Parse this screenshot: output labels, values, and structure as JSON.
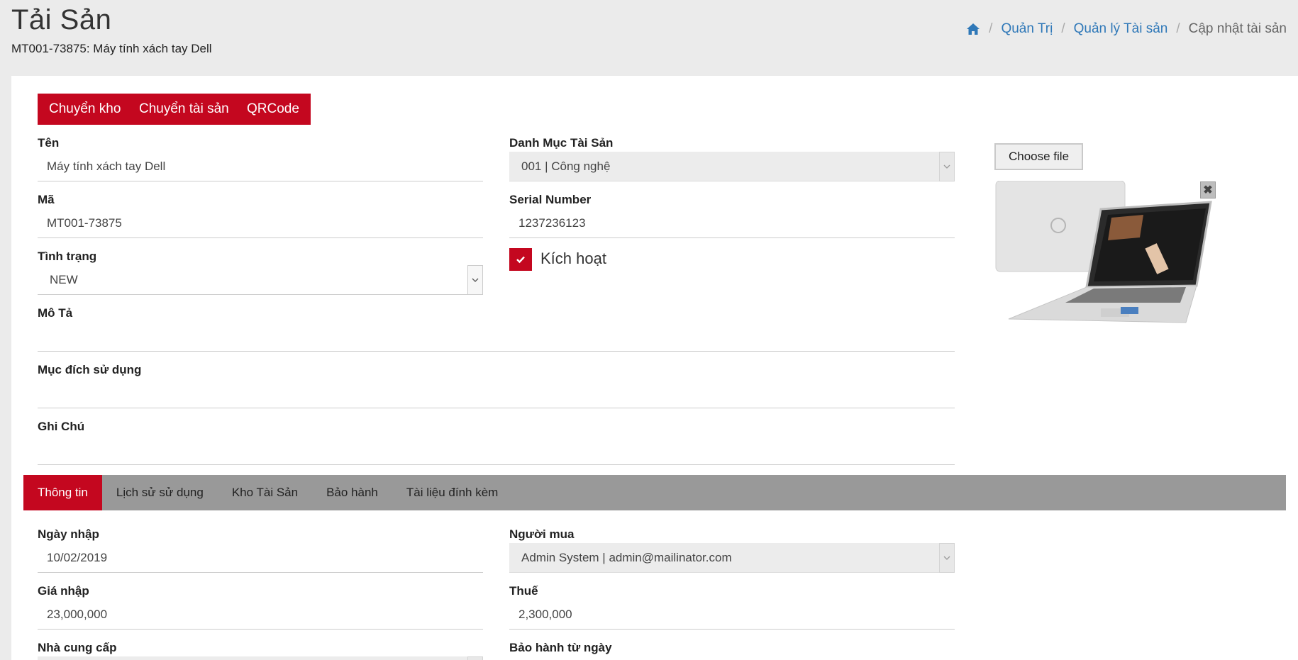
{
  "header": {
    "title": "Tải Sản",
    "subtitle": "MT001-73875: Máy tính xách tay Dell"
  },
  "breadcrumb": {
    "home_icon": "home-icon",
    "items": [
      "Quản Trị",
      "Quản lý Tài sản"
    ],
    "current": "Cập nhật tài sản",
    "separator": "/"
  },
  "actions": {
    "transfer_warehouse": "Chuyển kho",
    "transfer_asset": "Chuyển tài sản",
    "qrcode": "QRCode"
  },
  "form": {
    "name": {
      "label": "Tên",
      "value": "Máy tính xách tay Dell"
    },
    "category": {
      "label": "Danh Mục Tài Sản",
      "value": "001 | Công nghệ"
    },
    "code": {
      "label": "Mã",
      "value": "MT001-73875"
    },
    "serial": {
      "label": "Serial Number",
      "value": "1237236123"
    },
    "status": {
      "label": "Tình trạng",
      "value": "NEW"
    },
    "active": {
      "label": "Kích hoạt",
      "checked": true
    },
    "description": {
      "label": "Mô Tả",
      "value": ""
    },
    "purpose": {
      "label": "Mục đích sử dụng",
      "value": ""
    },
    "note": {
      "label": "Ghi Chú",
      "value": ""
    }
  },
  "upload": {
    "choose_file": "Choose file",
    "close_symbol": "✖"
  },
  "tabs": [
    {
      "label": "Thông tin",
      "active": true
    },
    {
      "label": "Lịch sử sử dụng",
      "active": false
    },
    {
      "label": "Kho Tài Sản",
      "active": false
    },
    {
      "label": "Bảo hành",
      "active": false
    },
    {
      "label": "Tài liệu đính kèm",
      "active": false
    }
  ],
  "info": {
    "import_date": {
      "label": "Ngày nhập",
      "value": "10/02/2019"
    },
    "buyer": {
      "label": "Người mua",
      "value": "Admin System | admin@mailinator.com"
    },
    "import_price": {
      "label": "Giá nhập",
      "value": "23,000,000"
    },
    "tax": {
      "label": "Thuế",
      "value": "2,300,000"
    },
    "supplier": {
      "label": "Nhà cung cấp",
      "value": ""
    },
    "warranty_from": {
      "label": "Bảo hành từ ngày",
      "value": ""
    }
  },
  "colors": {
    "accent": "#c4071f",
    "link": "#2f78b8",
    "tabs_bg": "#999999",
    "page_bg": "#ebebeb"
  }
}
